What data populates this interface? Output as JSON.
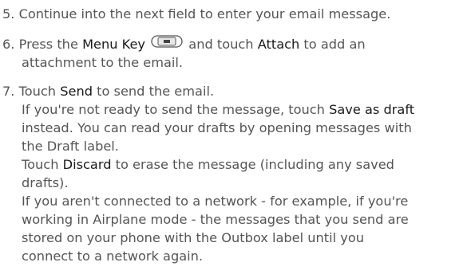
{
  "step5": {
    "text": "5. Continue into the next field to enter your email message."
  },
  "step6": {
    "prefix": "6. Press the ",
    "menu_key": "Menu Key",
    "icon": "menu-key-icon",
    "mid": " and touch ",
    "attach": "Attach",
    "suffix": " to add an",
    "line2": "attachment to the email."
  },
  "step7": {
    "prefix": "7. Touch ",
    "send": "Send",
    "suffix": " to send the email.",
    "l2_prefix": "If you're not ready to send the message, touch ",
    "save_as_draft": "Save as draft",
    "l3": "instead. You can read your drafts by opening messages with",
    "l4": "the Draft label.",
    "l5_prefix": "Touch ",
    "discard": "Discard",
    "l5_suffix": " to erase the message (including any saved",
    "l6": "drafts).",
    "l7": "If you aren't connected to a network - for example, if you're",
    "l8": "working in Airplane mode - the messages that you send are",
    "l9": "stored on your phone with the Outbox label until you",
    "l10": "connect to a network again."
  }
}
